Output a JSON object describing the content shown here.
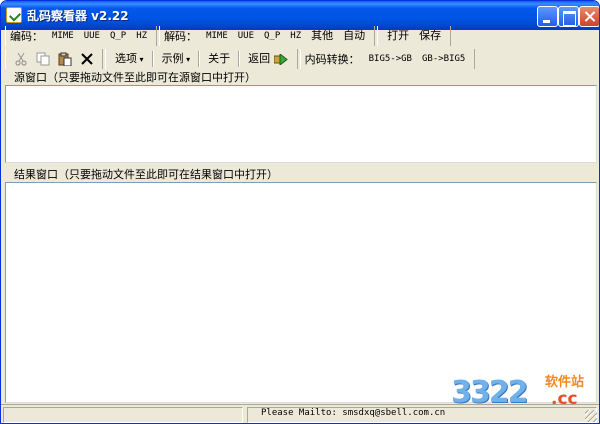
{
  "window": {
    "title": "乱码察看器 v2.22",
    "controls": {
      "minimize": "",
      "maximize": "",
      "close": ""
    }
  },
  "toolbar1": {
    "encode_label": "编码：",
    "encode_items": [
      "MIME",
      "UUE",
      "Q_P",
      "HZ"
    ],
    "decode_label": "解码：",
    "decode_items": [
      "MIME",
      "UUE",
      "Q_P",
      "HZ",
      "其他",
      "自动"
    ],
    "open": "打开",
    "save": "保存"
  },
  "toolbar2": {
    "icons": [
      "cut-icon",
      "copy-icon",
      "paste-icon",
      "delete-icon"
    ],
    "options": "选项",
    "examples": "示例",
    "about": "关于",
    "back": "返回",
    "convert_label": "内码转换：",
    "big5_to_gb": "BIG5->GB",
    "gb_to_big5": "GB->BIG5"
  },
  "source_pane": {
    "label": "源窗口（只要拖动文件至此即可在源窗口中打开）",
    "content": ""
  },
  "result_pane": {
    "label": "结果窗口（只要拖动文件至此即可在结果窗口中打开）",
    "content": ""
  },
  "statusbar": {
    "text": "Please Mailto: smsdxq@sbell.com.cn"
  },
  "watermark": {
    "number": "3322",
    "cn": "软件站",
    "cc": ".cc"
  },
  "colors": {
    "titlebar": "#0054e3",
    "face": "#ece9d8",
    "watermark_blue": "#6fb1e8",
    "watermark_orange": "#f08a1e"
  }
}
